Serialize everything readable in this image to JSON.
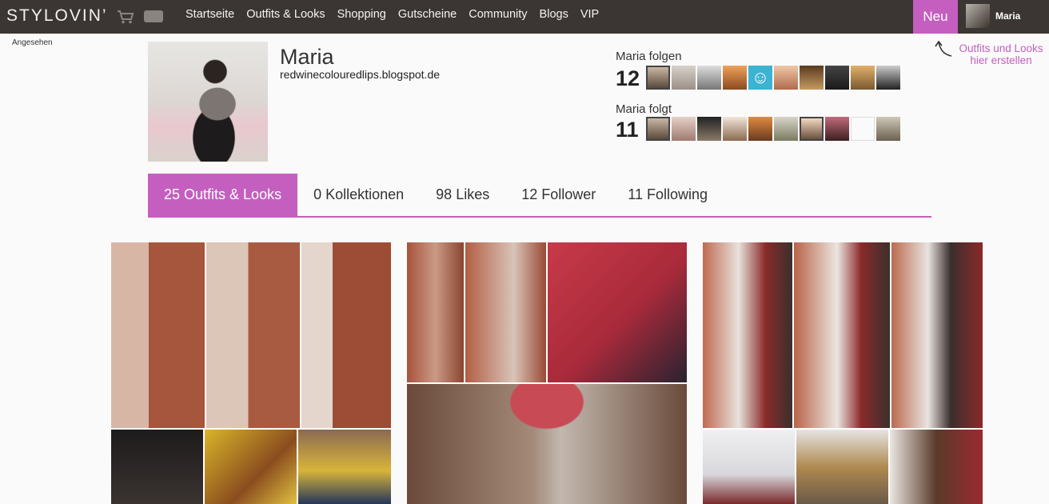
{
  "topbar": {
    "logo": "STYLOVIN’",
    "nav": [
      "Startseite",
      "Outfits & Looks",
      "Shopping",
      "Gutscheine",
      "Community",
      "Blogs",
      "VIP"
    ],
    "neu_label": "Neu",
    "user_name": "Maria"
  },
  "seen_label": "Angesehen",
  "hint": "Outfits und Looks hier erstellen",
  "profile": {
    "name": "Maria",
    "blog": "redwinecolouredlips.blogspot.de"
  },
  "followers": {
    "label": "Maria folgen",
    "count": "12"
  },
  "following": {
    "label": "Maria folgt",
    "count": "11"
  },
  "tabs": [
    "25 Outfits & Looks",
    "0 Kollektionen",
    "98 Likes",
    "12 Follower",
    "11 Following"
  ],
  "colors": {
    "accent": "#c45fbf",
    "topbar": "#3b3633"
  }
}
